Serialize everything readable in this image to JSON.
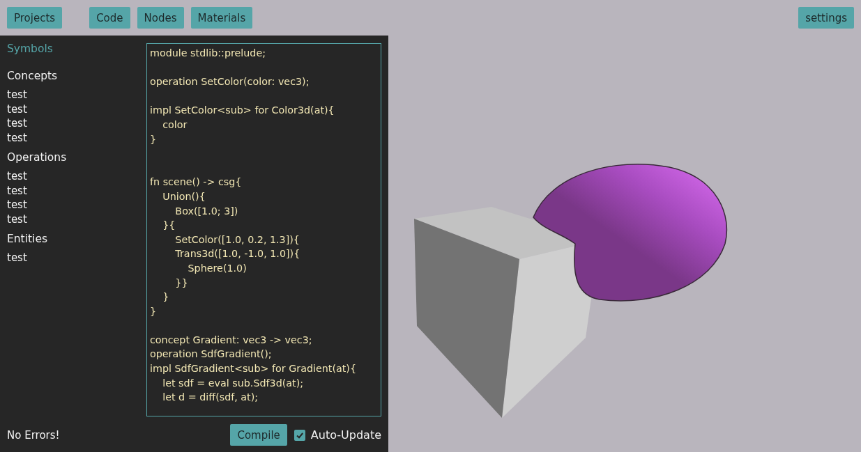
{
  "toolbar": {
    "left_buttons": [
      "Projects"
    ],
    "view_buttons": [
      "Code",
      "Nodes",
      "Materials"
    ],
    "right_buttons": [
      "settings"
    ]
  },
  "sidebar": {
    "title": "Symbols",
    "sections": [
      {
        "heading": "Concepts",
        "items": [
          "test",
          "test",
          "test",
          "test"
        ]
      },
      {
        "heading": "Operations",
        "items": [
          "test",
          "test",
          "test",
          "test"
        ]
      },
      {
        "heading": "Entities",
        "items": [
          "test"
        ]
      }
    ]
  },
  "editor": {
    "code": "module stdlib::prelude;\n\noperation SetColor(color: vec3);\n\nimpl SetColor<sub> for Color3d(at){\n    color\n}\n\n\nfn scene() -> csg{\n    Union(){\n        Box([1.0; 3])\n    }{\n        SetColor([1.0, 0.2, 1.3]){\n        Trans3d([1.0, -1.0, 1.0]){\n            Sphere(1.0)\n        }}\n    }\n}\n\nconcept Gradient: vec3 -> vec3;\noperation SdfGradient();\nimpl SdfGradient<sub> for Gradient(at){\n    let sdf = eval sub.Sdf3d(at);\n    let d = diff(sdf, at);"
  },
  "status": "No Errors!",
  "compile_button": "Compile",
  "auto_update": {
    "label": "Auto-Update",
    "checked": true
  }
}
